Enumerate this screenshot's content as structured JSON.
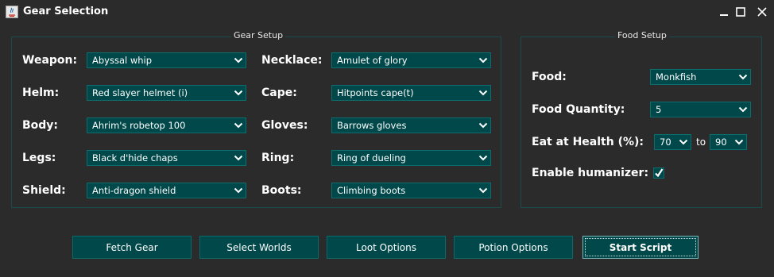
{
  "window": {
    "title": "Gear Selection",
    "controls": {
      "minimize": "minimize-icon",
      "maximize": "maximize-icon",
      "close": "close-icon"
    }
  },
  "gear_setup": {
    "legend": "Gear Setup",
    "left": [
      {
        "label": "Weapon:",
        "value": "Abyssal whip"
      },
      {
        "label": "Helm:",
        "value": "Red slayer helmet (i)"
      },
      {
        "label": "Body:",
        "value": "Ahrim's robetop 100"
      },
      {
        "label": "Legs:",
        "value": "Black d'hide chaps"
      },
      {
        "label": "Shield:",
        "value": "Anti-dragon shield"
      }
    ],
    "right": [
      {
        "label": "Necklace:",
        "value": "Amulet of glory"
      },
      {
        "label": "Cape:",
        "value": "Hitpoints cape(t)"
      },
      {
        "label": "Gloves:",
        "value": "Barrows gloves"
      },
      {
        "label": "Ring:",
        "value": "Ring of dueling"
      },
      {
        "label": "Boots:",
        "value": "Climbing boots"
      }
    ]
  },
  "food_setup": {
    "legend": "Food Setup",
    "food_label": "Food:",
    "food_value": "Monkfish",
    "quantity_label": "Food Quantity:",
    "quantity_value": "5",
    "eat_label": "Eat at Health (%):",
    "eat_min": "70",
    "to_text": "to",
    "eat_max": "90",
    "humanizer_label": "Enable humanizer:",
    "humanizer_checked": true
  },
  "buttons": {
    "fetch_gear": "Fetch Gear",
    "select_worlds": "Select Worlds",
    "loot_options": "Loot Options",
    "potion_options": "Potion Options",
    "start_script": "Start Script"
  },
  "colors": {
    "background": "#2b2b2b",
    "control_fill": "#00484a",
    "panel_border": "#1d4a4a",
    "text": "#ffffff"
  }
}
